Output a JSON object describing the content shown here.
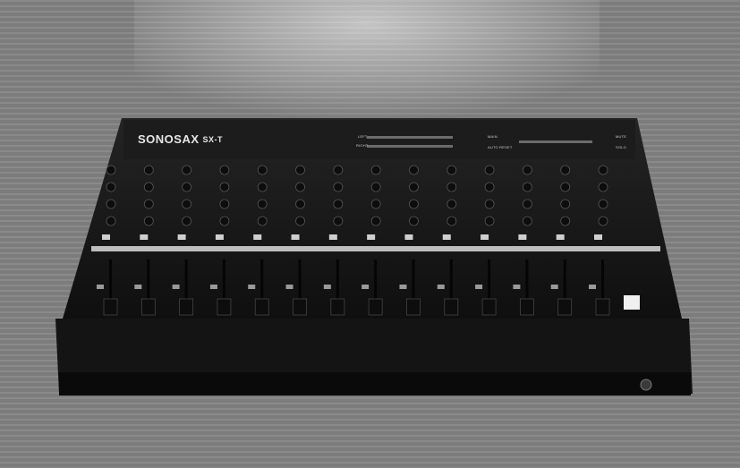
{
  "photo": {
    "subject": "mixing-console",
    "brand": "SONOSAX",
    "model": "SX-T",
    "meter_labels": {
      "left": "LEFT",
      "right": "RIGHT"
    },
    "indicator_labels": {
      "main": "MAIN",
      "mute": "MUTE",
      "solo": "SOLO",
      "auto_reset": "AUTO RESET"
    },
    "colors": {
      "backdrop": "#7c7c7c",
      "console_body": "#1b1b1b",
      "panel": "#2a2a2a",
      "divider_strip": "#bdbdbd",
      "fader_knob": "#0d0d0d",
      "highlight": "#f0f0f0"
    },
    "channel_strips": 14
  }
}
